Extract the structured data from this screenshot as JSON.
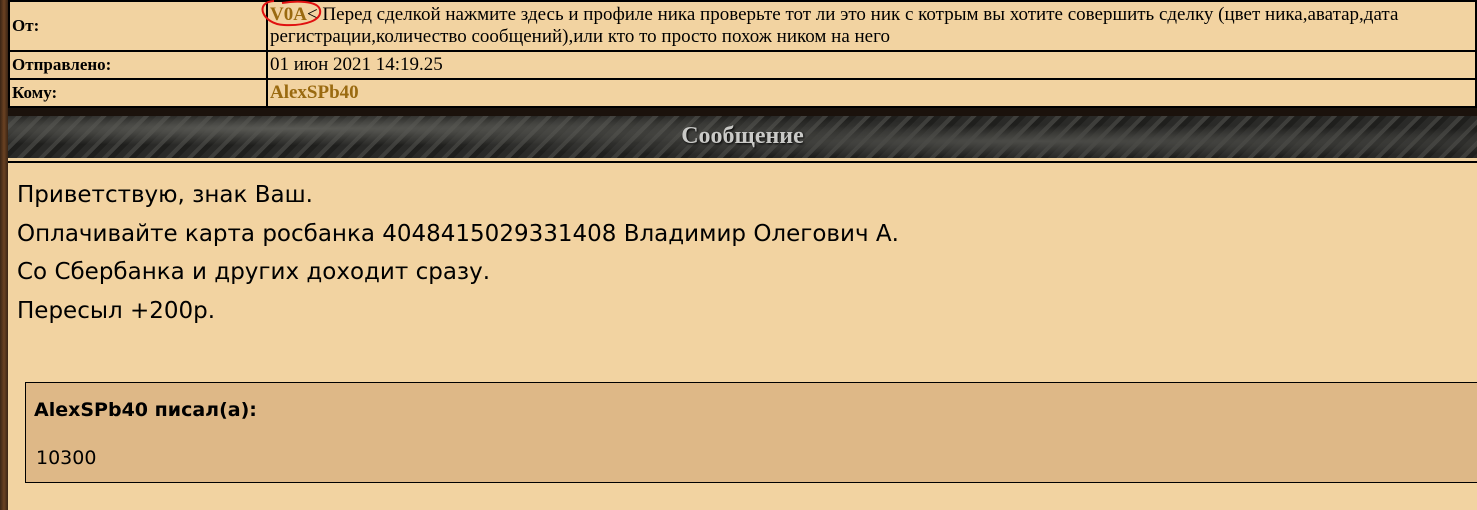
{
  "header": {
    "from_label": "От:",
    "from_nick": "V0A",
    "from_annotation": "< Перед сделкой нажмите здесь и профиле ника проверьте тот ли это ник с котрым вы хотите совершить сделку (цвет ника,аватар,дата регистрации,количество сообщений),или кто то просто похож ником на него",
    "sent_label": "Отправлено:",
    "sent_value": "01 июн 2021 14:19.25",
    "to_label": "Кому:",
    "to_nick": "AlexSPb40"
  },
  "band": {
    "title": "Сообщение"
  },
  "message": {
    "lines": [
      "Приветствую, знак Ваш.",
      "Оплачивайте карта росбанка 4048415029331408 Владимир Олегович А.",
      "Со Сбербанка и других доходит сразу.",
      "Пересыл +200р."
    ]
  },
  "quote": {
    "author": "AlexSPb40 писал(а):",
    "text": "10300"
  },
  "colors": {
    "nick": "#9a6a10",
    "background": "#f2d3a1",
    "quote_background": "#deb887",
    "annotation_circle": "#e01010"
  }
}
